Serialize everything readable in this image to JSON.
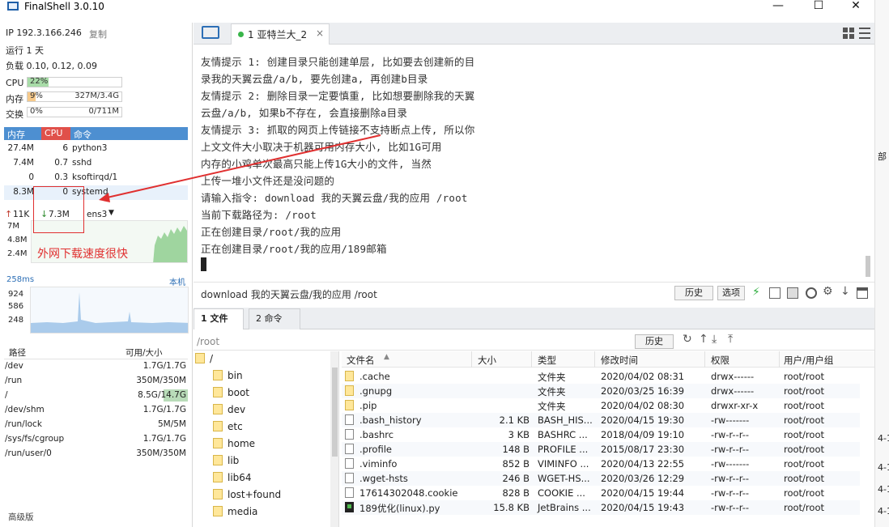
{
  "app": {
    "title": "FinalShell 3.0.10"
  },
  "window_controls": {
    "minimize": "—",
    "maximize": "☐",
    "close": "✕"
  },
  "left": {
    "ip_label": "IP 192.3.166.246",
    "copy_label": "复制",
    "uptime": "运行 1 天",
    "load": "负载 0.10, 0.12, 0.09",
    "cpu": {
      "label": "CPU",
      "value": "22%",
      "fraction": 0.22
    },
    "mem": {
      "label": "内存",
      "value": "9%",
      "detail": "327M/3.4G",
      "fraction": 0.09
    },
    "swap": {
      "label": "交换",
      "value": "0%",
      "detail": "0/711M",
      "fraction": 0.0
    },
    "proc_headers": {
      "mem": "内存",
      "cpu": "CPU",
      "cmd": "命令"
    },
    "processes": [
      {
        "mem": "27.4M",
        "cpu": "6",
        "cmd": "python3"
      },
      {
        "mem": "7.4M",
        "cpu": "0.7",
        "cmd": "sshd"
      },
      {
        "mem": "0",
        "cpu": "0.3",
        "cmd": "ksoftirqd/1"
      },
      {
        "mem": "8.3M",
        "cpu": "0",
        "cmd": "systemd"
      }
    ],
    "net": {
      "up": "11K",
      "down": "7.3M",
      "iface": "ens3"
    },
    "net_scale": [
      "7M",
      "4.8M",
      "2.4M"
    ],
    "ping": {
      "label": "258ms",
      "host": "本机",
      "scale": [
        "924",
        "586",
        "248"
      ]
    },
    "disk_headers": {
      "path": "路径",
      "usage": "可用/大小"
    },
    "disks": [
      {
        "path": "/dev",
        "usage": "1.7G/1.7G"
      },
      {
        "path": "/run",
        "usage": "350M/350M"
      },
      {
        "path": "/",
        "usage": "8.5G/14.7G"
      },
      {
        "path": "/dev/shm",
        "usage": "1.7G/1.7G"
      },
      {
        "path": "/run/lock",
        "usage": "5M/5M"
      },
      {
        "path": "/sys/fs/cgroup",
        "usage": "1.7G/1.7G"
      },
      {
        "path": "/run/user/0",
        "usage": "350M/350M"
      }
    ],
    "advanced": "高级版",
    "annotation": "外网下载速度很快"
  },
  "session_tab": {
    "label": "1 亚特兰大_2",
    "close": "×"
  },
  "terminal_lines": [
    "友情提示 1: 创建目录只能创建单层, 比如要去创建新的目",
    "录我的天翼云盘/a/b, 要先创建a, 再创建b目录",
    "友情提示 2: 删除目录一定要慎重, 比如想要删除我的天翼",
    "云盘/a/b, 如果b不存在, 会直接删除a目录",
    "友情提示 3: 抓取的网页上传链接不支持断点上传, 所以你",
    "上文文件大小取决于机器可用内存大小, 比如1G可用",
    "内存的小鸡单次最高只能上传1G大小的文件, 当然",
    "上传一堆小文件还是没问题的",
    "请输入指令: download 我的天翼云盘/我的应用 /root",
    "当前下载路径为: /root",
    "正在创建目录/root/我的应用",
    "正在创建目录/root/我的应用/189邮箱"
  ],
  "command_bar": {
    "text": "download 我的天翼云盘/我的应用 /root",
    "history": "历史",
    "options": "选项"
  },
  "file_tabs": {
    "files": "1 文件",
    "commands": "2 命令"
  },
  "path": {
    "value": "/root",
    "history": "历史"
  },
  "tree": [
    {
      "name": "/",
      "root": true
    },
    {
      "name": "bin"
    },
    {
      "name": "boot"
    },
    {
      "name": "dev"
    },
    {
      "name": "etc"
    },
    {
      "name": "home"
    },
    {
      "name": "lib"
    },
    {
      "name": "lib64"
    },
    {
      "name": "lost+found"
    },
    {
      "name": "media"
    }
  ],
  "file_headers": {
    "name": "文件名",
    "size": "大小",
    "type": "类型",
    "mtime": "修改时间",
    "perm": "权限",
    "owner": "用户/用户组"
  },
  "files": [
    {
      "icon": "folder",
      "name": ".cache",
      "size": "",
      "type": "文件夹",
      "mtime": "2020/04/02 08:31",
      "perm": "drwx------",
      "owner": "root/root"
    },
    {
      "icon": "folder",
      "name": ".gnupg",
      "size": "",
      "type": "文件夹",
      "mtime": "2020/03/25 16:39",
      "perm": "drwx------",
      "owner": "root/root"
    },
    {
      "icon": "folder",
      "name": ".pip",
      "size": "",
      "type": "文件夹",
      "mtime": "2020/04/02 08:30",
      "perm": "drwxr-xr-x",
      "owner": "root/root"
    },
    {
      "icon": "file",
      "name": ".bash_history",
      "size": "2.1 KB",
      "type": "BASH_HIS...",
      "mtime": "2020/04/15 19:30",
      "perm": "-rw-------",
      "owner": "root/root"
    },
    {
      "icon": "file",
      "name": ".bashrc",
      "size": "3 KB",
      "type": "BASHRC ...",
      "mtime": "2018/04/09 19:10",
      "perm": "-rw-r--r--",
      "owner": "root/root"
    },
    {
      "icon": "file",
      "name": ".profile",
      "size": "148 B",
      "type": "PROFILE ...",
      "mtime": "2015/08/17 23:30",
      "perm": "-rw-r--r--",
      "owner": "root/root"
    },
    {
      "icon": "file",
      "name": ".viminfo",
      "size": "852 B",
      "type": "VIMINFO ...",
      "mtime": "2020/04/13 22:55",
      "perm": "-rw-------",
      "owner": "root/root"
    },
    {
      "icon": "file",
      "name": ".wget-hsts",
      "size": "246 B",
      "type": "WGET-HS...",
      "mtime": "2020/03/26 12:29",
      "perm": "-rw-r--r--",
      "owner": "root/root"
    },
    {
      "icon": "file",
      "name": "17614302048.cookie",
      "size": "828 B",
      "type": "COOKIE ...",
      "mtime": "2020/04/15 19:44",
      "perm": "-rw-r--r--",
      "owner": "root/root"
    },
    {
      "icon": "py",
      "name": "189优化(linux).py",
      "size": "15.8 KB",
      "type": "JetBrains ...",
      "mtime": "2020/04/15 19:43",
      "perm": "-rw-r--r--",
      "owner": "root/root"
    }
  ],
  "edge_fragments": [
    "部",
    "4-1",
    "4-1",
    "4-1",
    "4-1"
  ],
  "colors": {
    "accent": "#4d8fd1",
    "cpu_head": "#e0504a",
    "annotation": "#e03030",
    "graph": "#8fcf8f",
    "ping": "#9cc3e8"
  }
}
